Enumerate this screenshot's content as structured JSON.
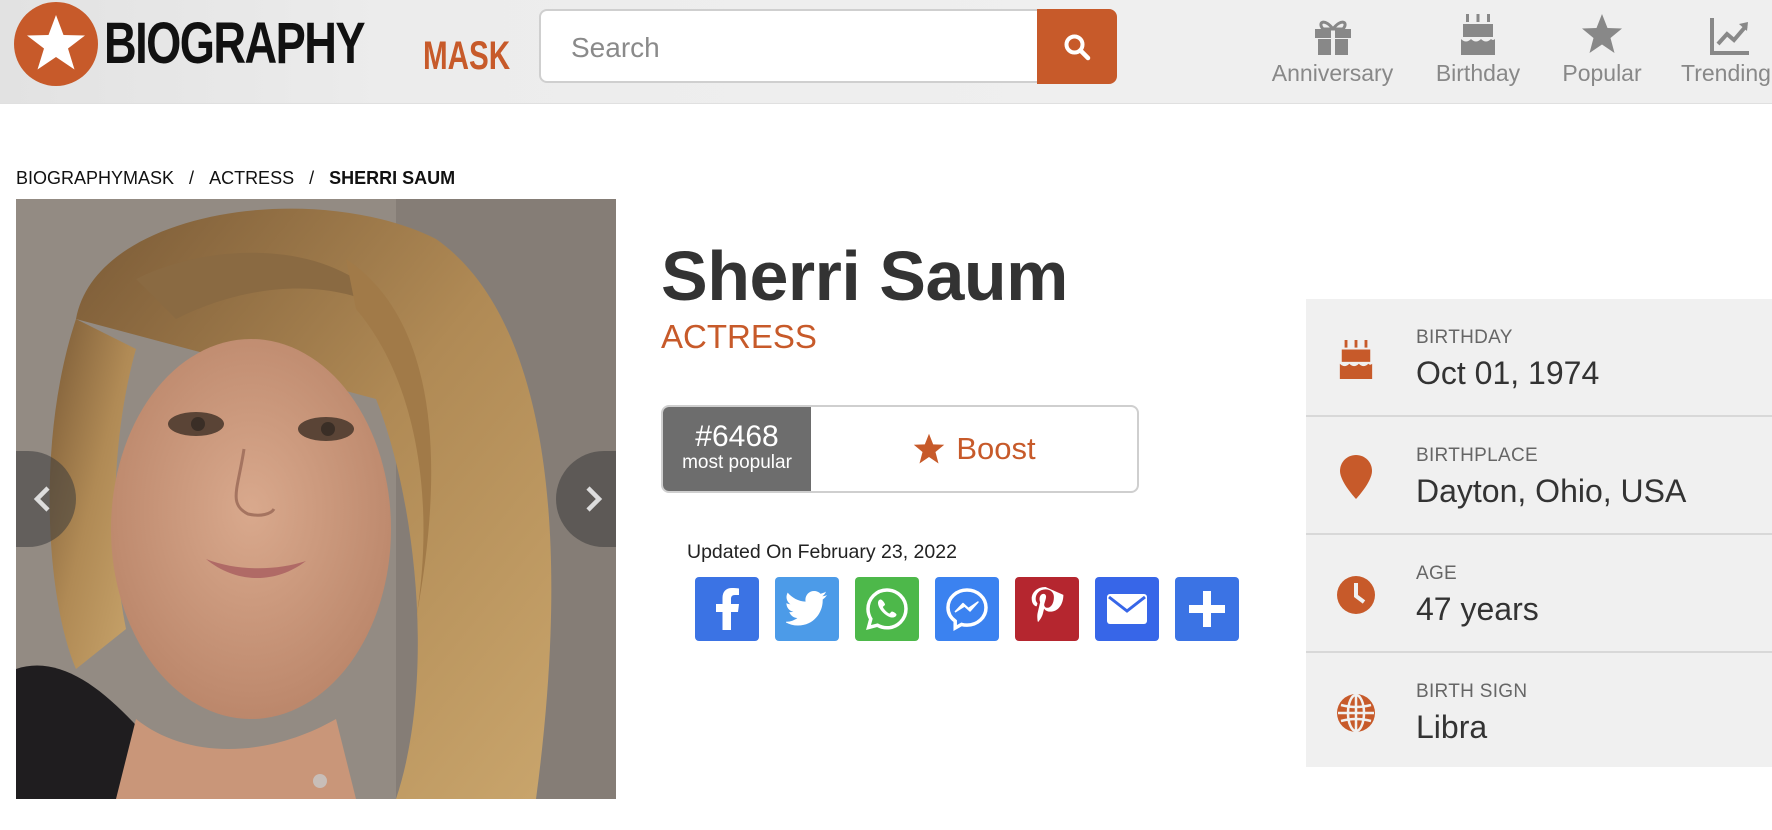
{
  "header": {
    "logo": {
      "primary": "BIOGRAPHY",
      "secondary": "MASK"
    },
    "search": {
      "placeholder": "Search"
    },
    "nav": [
      {
        "label": "Anniversary",
        "icon": "gift-icon"
      },
      {
        "label": "Birthday",
        "icon": "cake-icon"
      },
      {
        "label": "Popular",
        "icon": "star-icon"
      },
      {
        "label": "Trending",
        "icon": "trending-icon"
      }
    ]
  },
  "breadcrumb": {
    "items": [
      "BIOGRAPHYMASK",
      "ACTRESS"
    ],
    "separator": "/",
    "current": "SHERRI SAUM"
  },
  "profile": {
    "name": "Sherri Saum",
    "profession": "ACTRESS",
    "rank": "#6468",
    "rank_label": "most popular",
    "boost_label": "Boost",
    "updated": "Updated On February 23, 2022",
    "share_buttons": [
      {
        "name": "facebook",
        "color": "#3b73e4"
      },
      {
        "name": "twitter",
        "color": "#4c9be8"
      },
      {
        "name": "whatsapp",
        "color": "#4db84a"
      },
      {
        "name": "messenger",
        "color": "#3b82f0"
      },
      {
        "name": "pinterest",
        "color": "#b5262f"
      },
      {
        "name": "email",
        "color": "#3766e8"
      },
      {
        "name": "more",
        "color": "#3b73e4"
      }
    ]
  },
  "facts": [
    {
      "label": "BIRTHDAY",
      "value": "Oct 01, 1974",
      "icon": "cake-icon"
    },
    {
      "label": "BIRTHPLACE",
      "value": "Dayton, Ohio, USA",
      "icon": "location-pin-icon"
    },
    {
      "label": "AGE",
      "value": "47 years",
      "icon": "clock-icon"
    },
    {
      "label": "BIRTH SIGN",
      "value": "Libra",
      "icon": "globe-icon"
    }
  ],
  "colors": {
    "accent": "#c75a2a",
    "rank_bg": "#6d6d6d",
    "nav_gray": "#888888",
    "panel_bg": "#f0f0f0"
  }
}
